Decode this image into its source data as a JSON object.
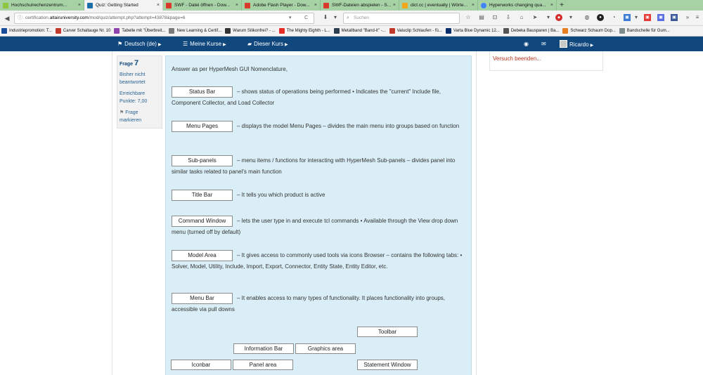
{
  "browser": {
    "tabs": [
      {
        "title": "Hochschulrechenzentrum...",
        "favicon_color": "#8dc63f",
        "active": false
      },
      {
        "title": "Quiz: Getting Started",
        "favicon_color": "#1c6ea4",
        "active": true
      },
      {
        "title": "SWF - Datei öffnen - Dow...",
        "favicon_color": "#d83b2b",
        "active": false
      },
      {
        "title": "Adobe Flash Player - Dow...",
        "favicon_color": "#d83b2b",
        "active": false
      },
      {
        "title": "SWF-Dateien abspielen - S...",
        "favicon_color": "#d83b2b",
        "active": false
      },
      {
        "title": "dict.cc | eventually | Wörte...",
        "favicon_color": "#f2a81d",
        "active": false
      },
      {
        "title": "Hyperworks changing qua...",
        "favicon_color": "#4285f4",
        "active": false
      }
    ],
    "tab_close": "×",
    "new_tab": "+",
    "url_prefix": "certification.",
    "url_host": "altairuniversity.com",
    "url_path": "/mod/quiz/attempt.php?attempt=43878&page=6",
    "url_reload": "C",
    "url_dropdown": "▾",
    "search_placeholder": "Suchen",
    "bookmarks": [
      {
        "label": "Industriepromotion: T...",
        "color": "#1a4c9c"
      },
      {
        "label": "Carver Schaltauge Nr. 10",
        "color": "#c0392b"
      },
      {
        "label": "Tabelle mit \"Überbreit...",
        "color": "#8e44ad"
      },
      {
        "label": "New Learning & Certif...",
        "color": "#7a7a7a"
      },
      {
        "label": "Warum Silikonfrei? - ...",
        "color": "#333333"
      },
      {
        "label": "The Mighty Eighth - L...",
        "color": "#e52d27"
      },
      {
        "label": "Metallband \"Band-it\" -...",
        "color": "#2c3e50"
      },
      {
        "label": "Valuclip Schlaufen - fü...",
        "color": "#c0392b"
      },
      {
        "label": "Varta Blue Dynamic 12...",
        "color": "#0b2e6b"
      },
      {
        "label": "Debeka Bausparen | Ba...",
        "color": "#555555"
      },
      {
        "label": "Schwarz Schaum Dop...",
        "color": "#e67e22"
      },
      {
        "label": "Bandschelle für Gum...",
        "color": "#7f8c8d"
      }
    ]
  },
  "site": {
    "header": {
      "language": "Deutsch (de)",
      "my_courses": "Meine Kurse",
      "this_course": "Dieser Kurs",
      "user": "Ricardo"
    },
    "question_info": {
      "label": "Frage",
      "number": "7",
      "status_1": "Bisher nicht",
      "status_2": "beantwortet",
      "points_1": "Erreichbare",
      "points_2": "Punkte: 7,00",
      "flag_1": "Frage",
      "flag_2": "markieren"
    },
    "finish_attempt": "Versuch beenden...",
    "question": {
      "intro": "Answer as per HyperMesh GUI Nomenclature,",
      "items": [
        {
          "answer": "Status Bar",
          "text": "– shows status of operations being performed • Indicates the \"current\" Include file, Component Collector, and Load Collector"
        },
        {
          "answer": "Menu Pages",
          "text": "– displays the model Menu Pages – divides the main menu into groups based on function"
        },
        {
          "answer": "Sub-panels",
          "text": "– menu items / functions for interacting with HyperMesh Sub-panels – divides panel into similar tasks related to panel's main function"
        },
        {
          "answer": "Title Bar",
          "text": "– It tells you which product is active"
        },
        {
          "answer": "Command Window",
          "text": "– lets the user type in and execute tcl commands • Available through the View drop down menu (turned off by default)"
        },
        {
          "answer": "Model Area",
          "text": "– It gives access to commonly used tools via icons Browser – contains the following tabs: • Solver, Model, Utility, Include, Import, Export, Connector, Entity State, Entity Editor, etc."
        },
        {
          "answer": "Menu Bar",
          "text": "– It enables access to many types of functionality. It places functionality into groups, accessible via pull downs"
        }
      ],
      "choices": [
        "Toolbar",
        "Information Bar",
        "Graphics area",
        "Iconbar",
        "Panel area",
        "Statement Window"
      ]
    }
  }
}
